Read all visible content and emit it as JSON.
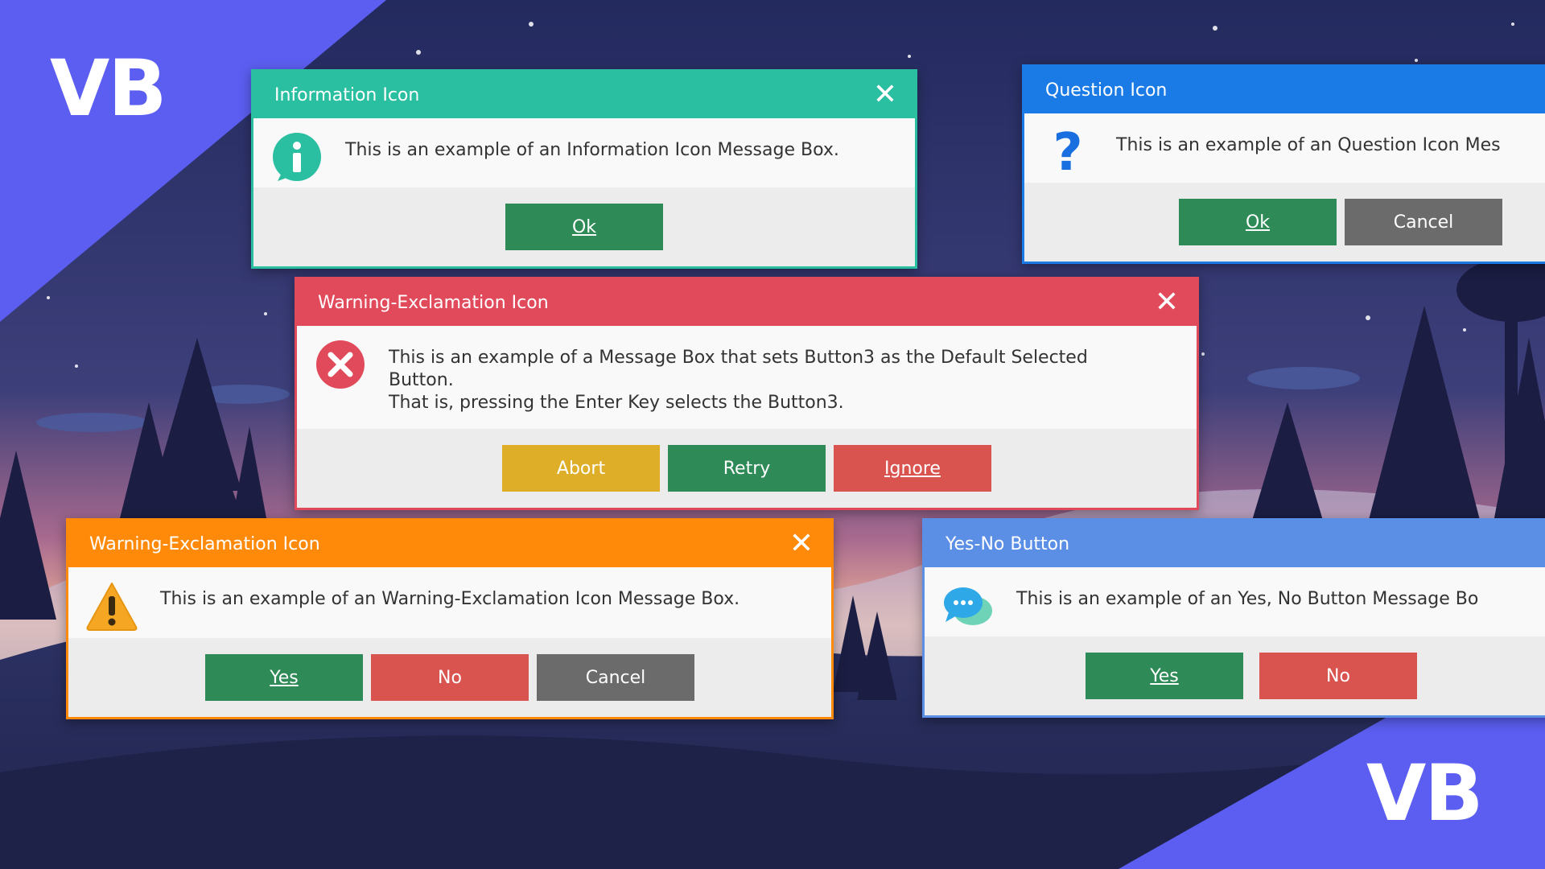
{
  "brand": {
    "top_left": "VB",
    "bottom_right": "VB",
    "color": "#5b5ef0"
  },
  "dialogs": {
    "info": {
      "title": "Information Icon",
      "message": "This is an example of an Information Icon Message Box.",
      "buttons": [
        "Ok"
      ],
      "icon": "information-icon",
      "accent": "#2bbfa1"
    },
    "question": {
      "title": "Question Icon",
      "message": "This is an example of an Question Icon Mes",
      "buttons": [
        "Ok",
        "Cancel"
      ],
      "icon": "question-icon",
      "accent": "#1a7be6"
    },
    "error": {
      "title": "Warning-Exclamation Icon",
      "message": "This is an example of a Message Box that sets Button3 as the Default Selected\nButton.\nThat is, pressing the Enter Key selects the Button3.",
      "buttons": [
        "Abort",
        "Retry",
        "Ignore"
      ],
      "icon": "error-icon",
      "accent": "#e04a5a"
    },
    "warning": {
      "title": "Warning-Exclamation Icon",
      "message": "This is an example of an Warning-Exclamation Icon Message Box.",
      "buttons": [
        "Yes",
        "No",
        "Cancel"
      ],
      "icon": "warning-icon",
      "accent": "#ff8a0a"
    },
    "yesno": {
      "title": "Yes-No Button",
      "message": "This is an example of an Yes, No Button Message Bo",
      "buttons": [
        "Yes",
        "No"
      ],
      "icon": "chat-bubble-icon",
      "accent": "#5b8fe6"
    }
  }
}
